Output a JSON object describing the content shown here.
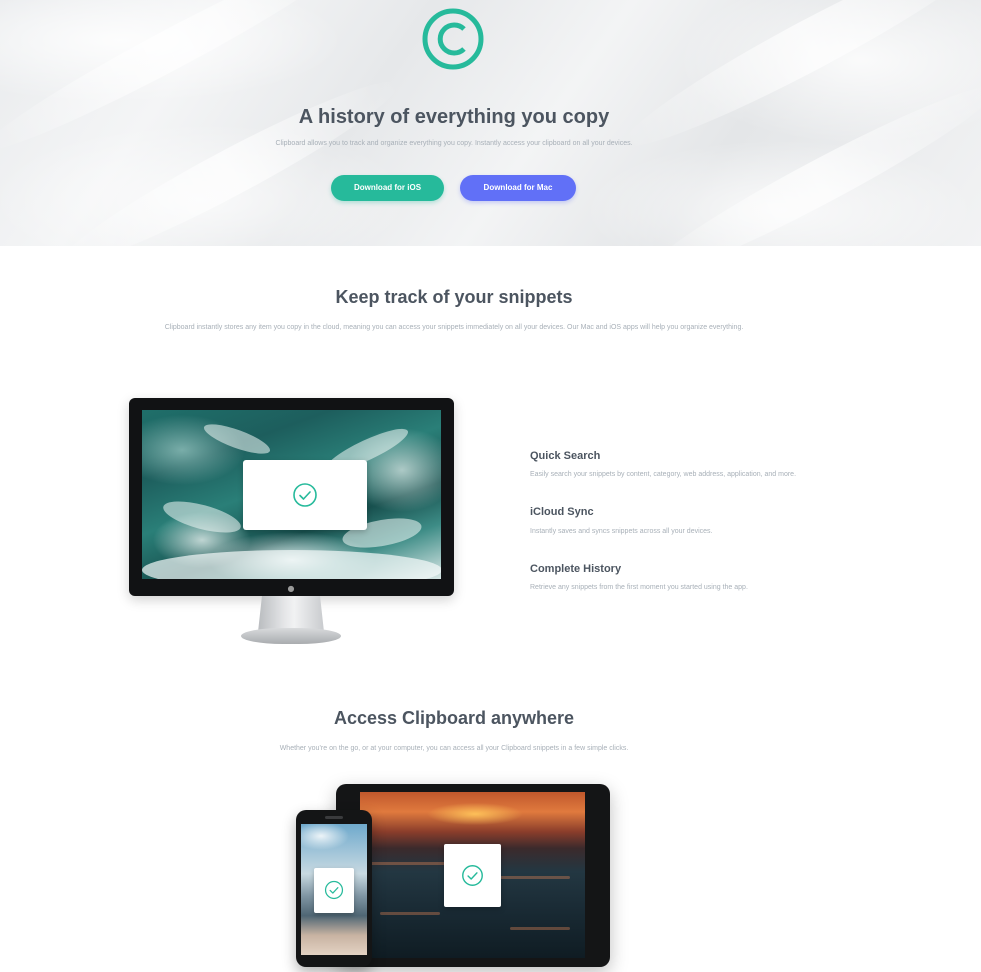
{
  "colors": {
    "accent_green": "#26ba9b",
    "accent_blue": "#6170f7",
    "heading": "#4c5560",
    "muted_text": "#a8b0b8"
  },
  "hero": {
    "logo_icon": "copyright-icon",
    "title": "A history of everything you copy",
    "subtitle": "Clipboard allows you to track and organize everything you copy. Instantly access your clipboard on all your devices.",
    "buttons": {
      "ios_label": "Download for iOS",
      "mac_label": "Download for Mac"
    }
  },
  "snippets": {
    "title": "Keep track of your snippets",
    "subtitle": "Clipboard instantly stores any item you copy in the cloud, meaning you can access your snippets immediately on all your devices. Our Mac and iOS apps will help you organize everything.",
    "features": [
      {
        "title": "Quick Search",
        "description": "Easily search your snippets by content, category, web address, application, and more."
      },
      {
        "title": "iCloud Sync",
        "description": "Instantly saves and syncs snippets across all your devices."
      },
      {
        "title": "Complete History",
        "description": "Retrieve any snippets from the first moment you started using the app."
      }
    ],
    "device_icon": "check-circle-icon"
  },
  "access": {
    "title": "Access Clipboard anywhere",
    "subtitle": "Whether you’re on the go, or at your computer, you can access all your Clipboard snippets in a few simple clicks."
  }
}
